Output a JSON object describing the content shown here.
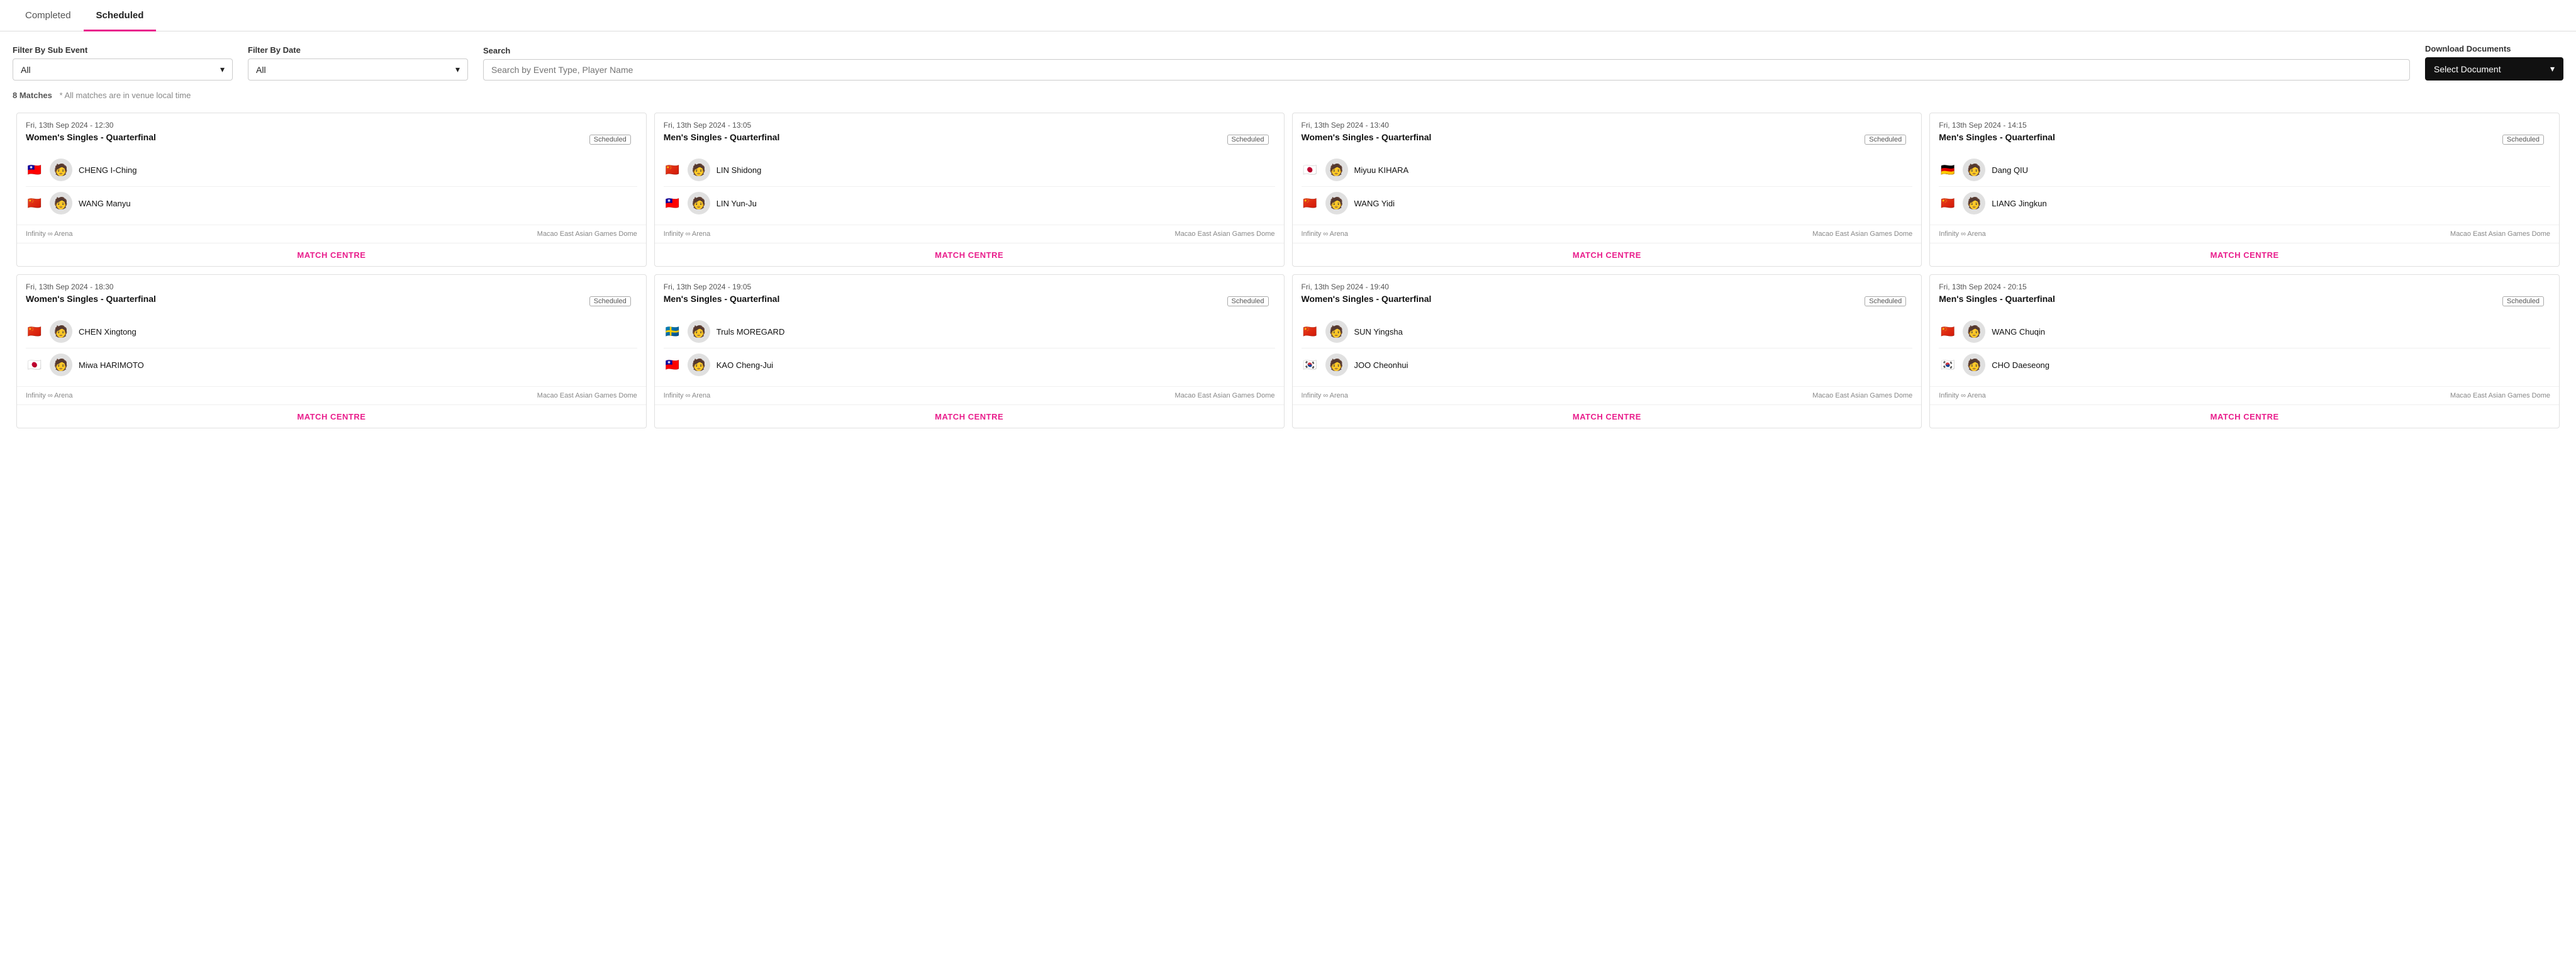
{
  "tabs": [
    {
      "id": "completed",
      "label": "Completed",
      "active": false
    },
    {
      "id": "scheduled",
      "label": "Scheduled",
      "active": true
    }
  ],
  "filters": {
    "sub_event": {
      "label": "Filter By Sub Event",
      "value": "All",
      "placeholder": "All"
    },
    "date": {
      "label": "Filter By Date",
      "value": "All",
      "placeholder": "All"
    },
    "search": {
      "label": "Search",
      "placeholder": "Search by Event Type, Player Name"
    },
    "download": {
      "label": "Download Documents",
      "value": "Select Document"
    }
  },
  "match_info": {
    "count": "8 Matches",
    "note": "* All matches are in venue local time"
  },
  "matches": [
    {
      "datetime": "Fri, 13th Sep 2024 - 12:30",
      "event": "Women's Singles - Quarterfinal",
      "status": "Scheduled",
      "players": [
        {
          "flag": "🇹🇼",
          "name": "CHENG I-Ching",
          "avatar": "👤"
        },
        {
          "flag": "🇨🇳",
          "name": "WANG Manyu",
          "avatar": "👤"
        }
      ],
      "venue_left": "Infinity ∞ Arena",
      "venue_right": "Macao East Asian Games Dome",
      "match_centre_label": "MATCH CENTRE"
    },
    {
      "datetime": "Fri, 13th Sep 2024 - 13:05",
      "event": "Men's Singles - Quarterfinal",
      "status": "Scheduled",
      "players": [
        {
          "flag": "🇨🇳",
          "name": "LIN Shidong",
          "avatar": "👤"
        },
        {
          "flag": "🇹🇼",
          "name": "LIN Yun-Ju",
          "avatar": "👤"
        }
      ],
      "venue_left": "Infinity ∞ Arena",
      "venue_right": "Macao East Asian Games Dome",
      "match_centre_label": "MATCH CENTRE"
    },
    {
      "datetime": "Fri, 13th Sep 2024 - 13:40",
      "event": "Women's Singles - Quarterfinal",
      "status": "Scheduled",
      "players": [
        {
          "flag": "🇯🇵",
          "name": "Miyuu KIHARA",
          "avatar": "👤"
        },
        {
          "flag": "🇨🇳",
          "name": "WANG Yidi",
          "avatar": "👤"
        }
      ],
      "venue_left": "Infinity ∞ Arena",
      "venue_right": "Macao East Asian Games Dome",
      "match_centre_label": "MATCH CENTRE"
    },
    {
      "datetime": "Fri, 13th Sep 2024 - 14:15",
      "event": "Men's Singles - Quarterfinal",
      "status": "Scheduled",
      "players": [
        {
          "flag": "🇩🇪",
          "name": "Dang QIU",
          "avatar": "👤"
        },
        {
          "flag": "🇨🇳",
          "name": "LIANG Jingkun",
          "avatar": "👤"
        }
      ],
      "venue_left": "Infinity ∞ Arena",
      "venue_right": "Macao East Asian Games Dome",
      "match_centre_label": "MATCH CENTRE"
    },
    {
      "datetime": "Fri, 13th Sep 2024 - 18:30",
      "event": "Women's Singles - Quarterfinal",
      "status": "Scheduled",
      "players": [
        {
          "flag": "🇨🇳",
          "name": "CHEN Xingtong",
          "avatar": "👤"
        },
        {
          "flag": "🇯🇵",
          "name": "Miwa HARIMOTO",
          "avatar": "👤"
        }
      ],
      "venue_left": "Infinity ∞ Arena",
      "venue_right": "Macao East Asian Games Dome",
      "match_centre_label": "MATCH CENTRE"
    },
    {
      "datetime": "Fri, 13th Sep 2024 - 19:05",
      "event": "Men's Singles - Quarterfinal",
      "status": "Scheduled",
      "players": [
        {
          "flag": "🇸🇪",
          "name": "Truls MOREGARD",
          "avatar": "👤"
        },
        {
          "flag": "🇹🇼",
          "name": "KAO Cheng-Jui",
          "avatar": "👤"
        }
      ],
      "venue_left": "Infinity ∞ Arena",
      "venue_right": "Macao East Asian Games Dome",
      "match_centre_label": "MATCH CENTRE"
    },
    {
      "datetime": "Fri, 13th Sep 2024 - 19:40",
      "event": "Women's Singles - Quarterfinal",
      "status": "Scheduled",
      "players": [
        {
          "flag": "🇨🇳",
          "name": "SUN Yingsha",
          "avatar": "👤"
        },
        {
          "flag": "🇰🇷",
          "name": "JOO Cheonhui",
          "avatar": "👤"
        }
      ],
      "venue_left": "Infinity ∞ Arena",
      "venue_right": "Macao East Asian Games Dome",
      "match_centre_label": "MATCH CENTRE"
    },
    {
      "datetime": "Fri, 13th Sep 2024 - 20:15",
      "event": "Men's Singles - Quarterfinal",
      "status": "Scheduled",
      "players": [
        {
          "flag": "🇨🇳",
          "name": "WANG Chuqin",
          "avatar": "👤"
        },
        {
          "flag": "🇰🇷",
          "name": "CHO Daeseong",
          "avatar": "👤"
        }
      ],
      "venue_left": "Infinity ∞ Arena",
      "venue_right": "Macao East Asian Games Dome",
      "match_centre_label": "MATCH CENTRE"
    }
  ],
  "colors": {
    "accent": "#e91e8c",
    "tab_active_underline": "#e91e8c"
  }
}
